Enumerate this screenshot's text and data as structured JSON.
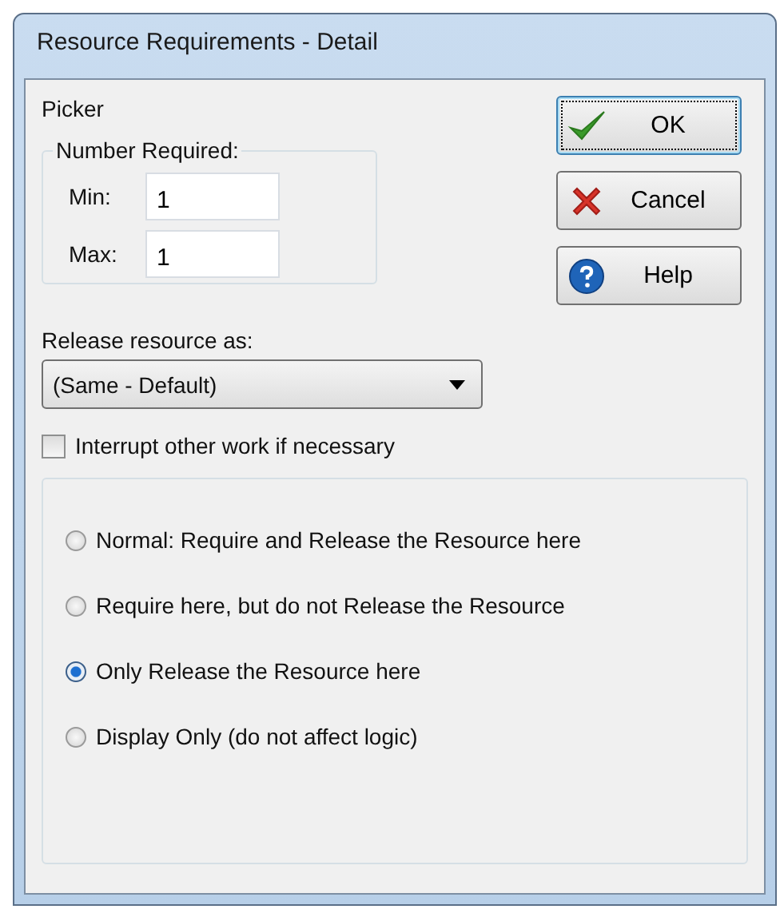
{
  "window": {
    "title": "Resource Requirements - Detail"
  },
  "resource_name": "Picker",
  "number_required": {
    "legend": "Number Required:",
    "min": {
      "label": "Min:",
      "value": "1"
    },
    "max": {
      "label": "Max:",
      "value": "1"
    }
  },
  "buttons": [
    {
      "kind": "ok",
      "label": "OK",
      "focused": true
    },
    {
      "kind": "cancel",
      "label": "Cancel",
      "focused": false
    },
    {
      "kind": "help",
      "label": "Help",
      "focused": false
    }
  ],
  "release_as": {
    "label": "Release resource as:",
    "value": "(Same - Default)"
  },
  "interrupt": {
    "label": "Interrupt other work if necessary",
    "checked": false
  },
  "modes": [
    {
      "label": "Normal: Require and Release the Resource here",
      "selected": false
    },
    {
      "label": "Require here, but do not Release the Resource",
      "selected": false
    },
    {
      "label": "Only Release the Resource here",
      "selected": true
    },
    {
      "label": "Display Only (do not affect logic)",
      "selected": false
    }
  ]
}
